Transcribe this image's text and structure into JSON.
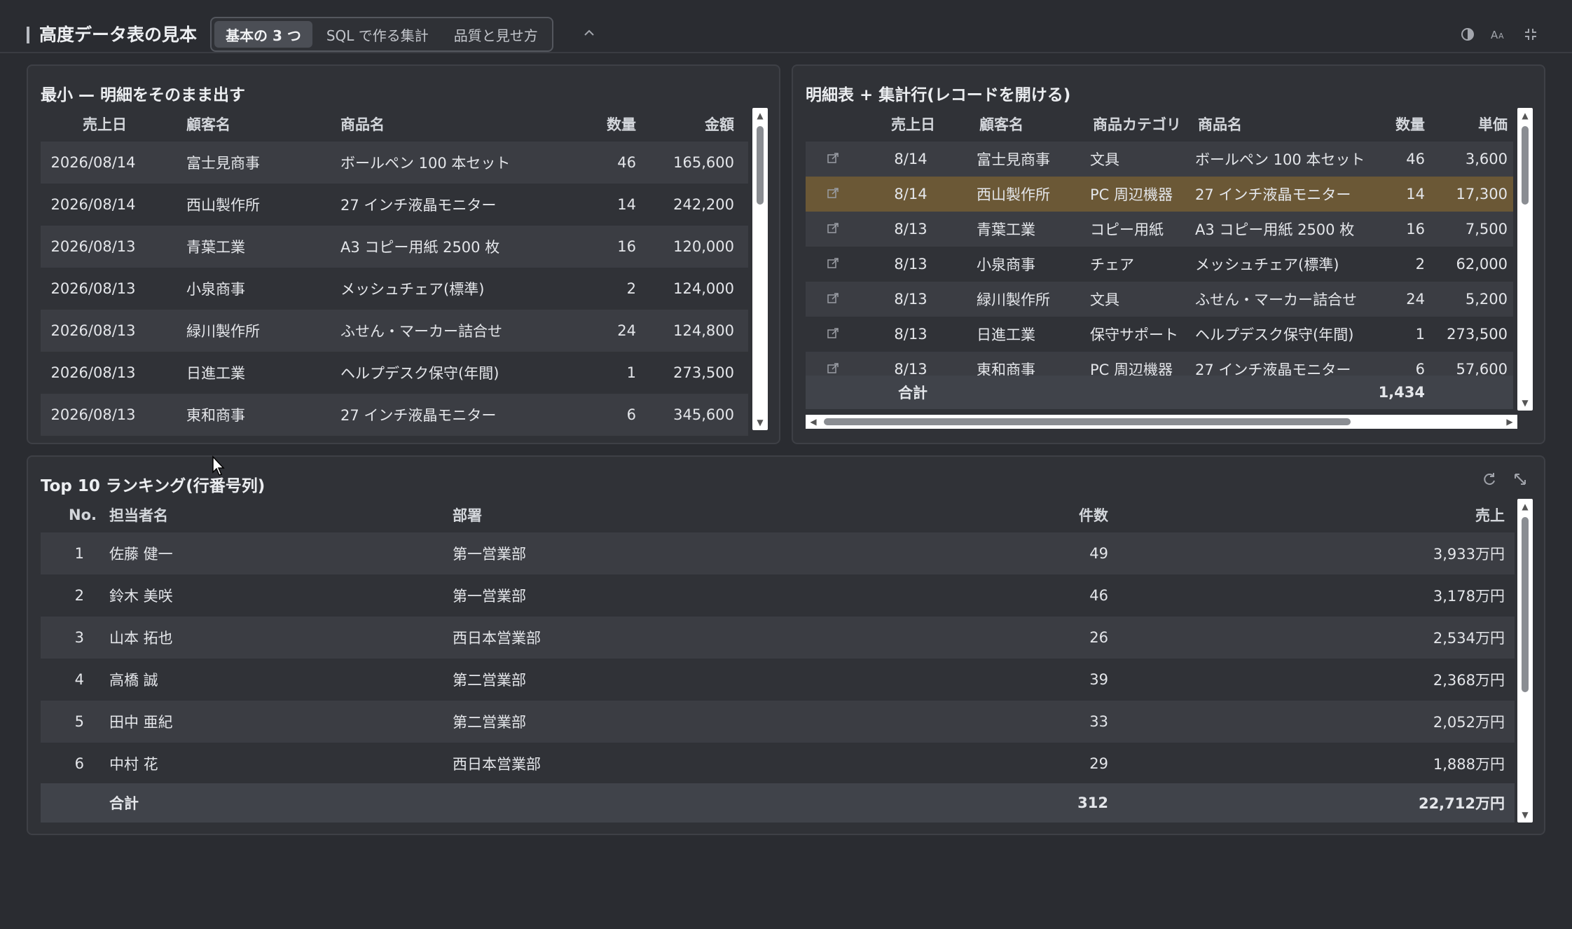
{
  "header": {
    "title": "高度データ表の見本",
    "tabs": [
      "基本の 3 つ",
      "SQL で作る集計",
      "品質と見せ方"
    ],
    "active_tab": 0
  },
  "panel1": {
    "title": "最小 — 明細をそのまま出す",
    "columns": [
      "売上日",
      "顧客名",
      "商品名",
      "数量",
      "金額"
    ],
    "rows": [
      [
        "2026/08/14",
        "富士見商事",
        "ボールペン 100 本セット",
        "46",
        "165,600"
      ],
      [
        "2026/08/14",
        "西山製作所",
        "27 インチ液晶モニター",
        "14",
        "242,200"
      ],
      [
        "2026/08/13",
        "青葉工業",
        "A3 コピー用紙 2500 枚",
        "16",
        "120,000"
      ],
      [
        "2026/08/13",
        "小泉商事",
        "メッシュチェア(標準)",
        "2",
        "124,000"
      ],
      [
        "2026/08/13",
        "緑川製作所",
        "ふせん・マーカー詰合せ",
        "24",
        "124,800"
      ],
      [
        "2026/08/13",
        "日進工業",
        "ヘルプデスク保守(年間)",
        "1",
        "273,500"
      ],
      [
        "2026/08/13",
        "東和商事",
        "27 インチ液晶モニター",
        "6",
        "345,600"
      ]
    ]
  },
  "panel2": {
    "title": "明細表 + 集計行(レコードを開ける)",
    "columns": [
      "売上日",
      "顧客名",
      "商品カテゴリ",
      "商品名",
      "数量",
      "単価"
    ],
    "rows": [
      [
        "8/14",
        "富士見商事",
        "文具",
        "ボールペン 100 本セット",
        "46",
        "3,600"
      ],
      [
        "8/14",
        "西山製作所",
        "PC 周辺機器",
        "27 インチ液晶モニター",
        "14",
        "17,300"
      ],
      [
        "8/13",
        "青葉工業",
        "コピー用紙",
        "A3 コピー用紙 2500 枚",
        "16",
        "7,500"
      ],
      [
        "8/13",
        "小泉商事",
        "チェア",
        "メッシュチェア(標準)",
        "2",
        "62,000"
      ],
      [
        "8/13",
        "緑川製作所",
        "文具",
        "ふせん・マーカー詰合せ",
        "24",
        "5,200"
      ],
      [
        "8/13",
        "日進工業",
        "保守サポート",
        "ヘルプデスク保守(年間)",
        "1",
        "273,500"
      ],
      [
        "8/13",
        "東和商事",
        "PC 周辺機器",
        "27 インチ液晶モニター",
        "6",
        "57,600"
      ]
    ],
    "highlight_row": 1,
    "total_label": "合計",
    "total_qty": "1,434"
  },
  "panel3": {
    "title": "Top 10 ランキング(行番号列)",
    "columns": [
      "No.",
      "担当者名",
      "部署",
      "件数",
      "売上"
    ],
    "rows": [
      [
        "1",
        "佐藤 健一",
        "第一営業部",
        "49",
        "3,933万円"
      ],
      [
        "2",
        "鈴木 美咲",
        "第一営業部",
        "46",
        "3,178万円"
      ],
      [
        "3",
        "山本 拓也",
        "西日本営業部",
        "26",
        "2,534万円"
      ],
      [
        "4",
        "高橋 誠",
        "第二営業部",
        "39",
        "2,368万円"
      ],
      [
        "5",
        "田中 亜紀",
        "第二営業部",
        "33",
        "2,052万円"
      ],
      [
        "6",
        "中村 花",
        "西日本営業部",
        "29",
        "1,888万円"
      ]
    ],
    "total_label": "合計",
    "total_count": "312",
    "total_sales": "22,712万円"
  },
  "icons": [
    "contrast-icon",
    "font-size-icon",
    "minimize-icon",
    "refresh-icon",
    "expand-icon",
    "open-record-icon",
    "chevron-up-icon"
  ],
  "colors": {
    "background": "#2a2c31",
    "panel": "#303237",
    "highlight": "#6b5836"
  }
}
